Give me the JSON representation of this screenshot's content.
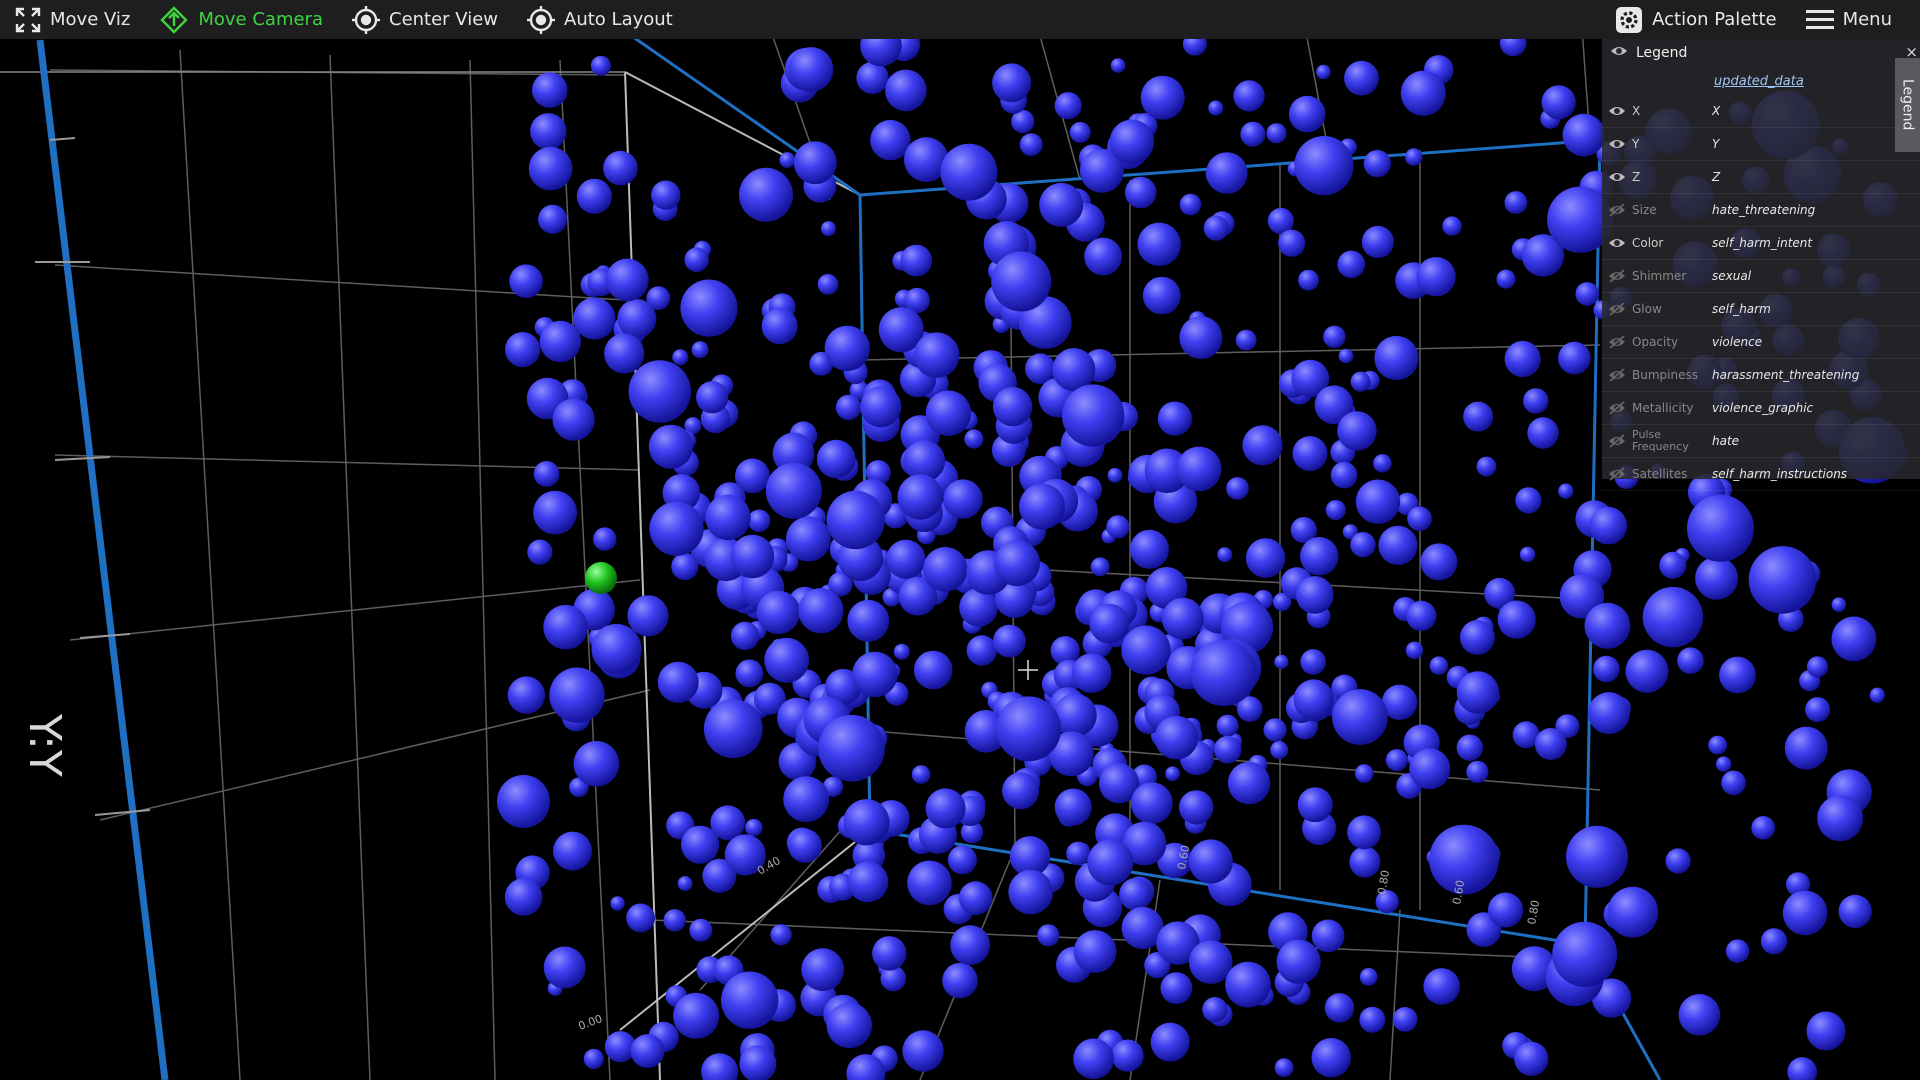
{
  "toolbar": {
    "move_viz": "Move Viz",
    "move_camera": "Move Camera",
    "center_view": "Center View",
    "auto_layout": "Auto Layout",
    "action_palette": "Action Palette",
    "menu": "Menu"
  },
  "legend": {
    "title": "Legend",
    "close": "×",
    "source": "updated_data",
    "tab_label": "Legend",
    "rows": [
      {
        "label": "X",
        "value": "X",
        "visible": true
      },
      {
        "label": "Y",
        "value": "Y",
        "visible": true
      },
      {
        "label": "Z",
        "value": "Z",
        "visible": true
      },
      {
        "label": "Size",
        "value": "hate_threatening",
        "visible": false
      },
      {
        "label": "Color",
        "value": "self_harm_intent",
        "visible": true
      },
      {
        "label": "Shimmer",
        "value": "sexual",
        "visible": false
      },
      {
        "label": "Glow",
        "value": "self_harm",
        "visible": false
      },
      {
        "label": "Opacity",
        "value": "violence",
        "visible": false
      },
      {
        "label": "Bumpiness",
        "value": "harassment_threatening",
        "visible": false
      },
      {
        "label": "Metallicity",
        "value": "violence_graphic",
        "visible": false
      },
      {
        "label": "Pulse Frequency",
        "value": "hate",
        "visible": false
      },
      {
        "label": "Satellites",
        "value": "self_harm_instructions",
        "visible": false
      }
    ]
  },
  "axis": {
    "y_title": "Y:Y",
    "ticks": [
      "0.00",
      "0.40",
      "0.60",
      "0.80",
      "0.60",
      "0.80"
    ]
  },
  "colors": {
    "sphere": "#3a3ae8",
    "highlight_sphere": "#22c322",
    "active_tool": "#3fd43f",
    "axis_blue": "#1f6fc2",
    "grid": "#6a6a6a"
  }
}
